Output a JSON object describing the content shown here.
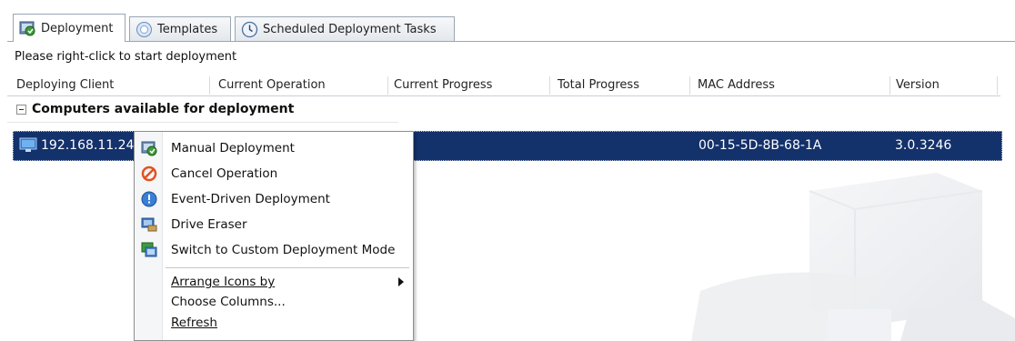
{
  "tabs": [
    {
      "label": "Deployment",
      "icon": "deployment-icon",
      "active": true
    },
    {
      "label": "Templates",
      "icon": "templates-icon",
      "active": false
    },
    {
      "label": "Scheduled Deployment Tasks",
      "icon": "clock-icon",
      "active": false
    }
  ],
  "hint": "Please right-click to start deployment",
  "columns": [
    "Deploying Client",
    "Current Operation",
    "Current Progress",
    "Total Progress",
    "MAC Address",
    "Version"
  ],
  "group": {
    "label": "Computers available for deployment",
    "expanded": true
  },
  "row": {
    "client": "192.168.11.24",
    "mac": "00-15-5D-8B-68-1A",
    "version": "3.0.3246",
    "icon": "computer-icon",
    "selected": true
  },
  "context_menu": {
    "items": [
      {
        "label": "Manual Deployment",
        "icon": "manual-deployment-icon"
      },
      {
        "label": "Cancel Operation",
        "icon": "cancel-icon"
      },
      {
        "label": "Event-Driven Deployment",
        "icon": "info-icon"
      },
      {
        "label": "Drive Eraser",
        "icon": "drive-eraser-icon"
      },
      {
        "label": "Switch to Custom Deployment Mode",
        "icon": "switch-mode-icon"
      }
    ],
    "secondary": [
      {
        "label": "Arrange Icons by",
        "has_submenu": true
      },
      {
        "label": "Choose Columns...",
        "has_submenu": false
      },
      {
        "label": "Refresh",
        "has_submenu": false
      }
    ]
  },
  "colors": {
    "selection": "#13316b",
    "border": "#9aa6b4"
  }
}
